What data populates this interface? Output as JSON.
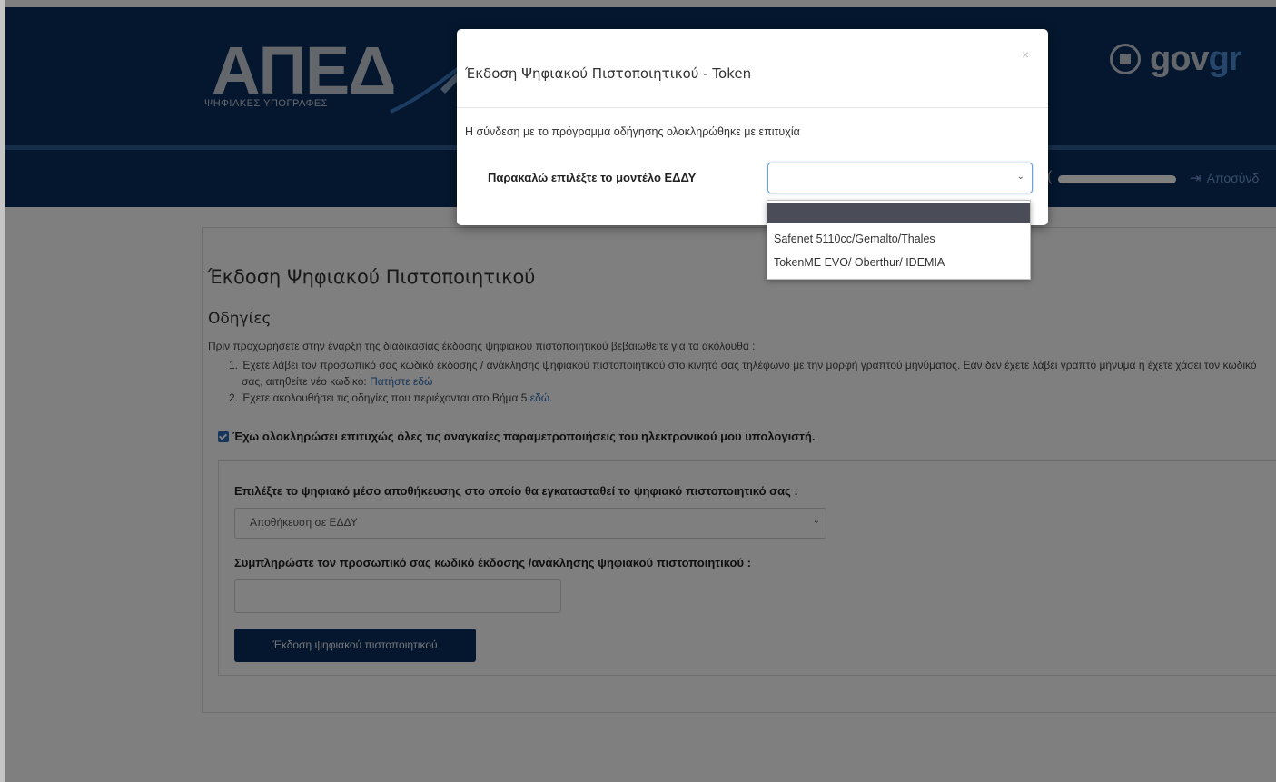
{
  "header": {
    "logo_text": "ΑΠΕΔ",
    "logo_subtitle": "ΨΗΦΙΑΚΕΣ ΥΠΟΓΡΑΦΕΣ",
    "gov_brand_gov": "gov",
    "gov_brand_gr": "gr",
    "user_paren": "(",
    "logout_label": "Αποσύνδ"
  },
  "main": {
    "title": "Έκδοση Ψηφιακού Πιστοποιητικού",
    "instructions_title": "Οδηγίες",
    "intro": "Πριν προχωρήσετε στην έναρξη της διαδικασίας έκδοσης ψηφιακού πιστοποιητικού βεβαιωθείτε για τα ακόλουθα :",
    "steps": [
      {
        "num": "1.",
        "text": "Έχετε λάβει τον προσωπικό σας κωδικό έκδοσης / ανάκλησης ψηφιακού πιστοποιητικού στο κινητό σας τηλέφωνο με την μορφή γραπτού μηνύματος. Εάν δεν έχετε λάβει γραπτό μήνυμα ή έχετε χάσει τον κωδικό σας, αιτηθείτε νέο κωδικό:",
        "link": "Πατήστε εδώ"
      },
      {
        "num": "2.",
        "text": "Έχετε ακολουθήσει τις οδηγίες που περιέχονται στο Βήμα 5",
        "link": "εδώ."
      }
    ],
    "checkbox_label": "Έχω ολοκληρώσει επιτυχώς όλες τις αναγκαίες παραμετροποιήσεις του ηλεκτρονικού μου υπολογιστή.",
    "storage_label": "Επιλέξτε το ψηφιακό μέσο αποθήκευσης στο οποίο θα εγκατασταθεί το ψηφιακό πιστοποιητικό σας :",
    "storage_value": "Αποθήκευση σε ΕΔΔΥ",
    "code_label": "Συμπληρώστε τον προσωπικό σας κωδικό έκδοσης /ανάκλησης ψηφιακού πιστοποιητικού :",
    "code_value": "",
    "issue_button": "Έκδοση ψηφιακού πιστοποιητικού"
  },
  "modal": {
    "title": "Έκδοση Ψηφιακού Πιστοποιητικού - Token",
    "close": "×",
    "message": "Η σύνδεση με το πρόγραμμα οδήγησης ολοκληρώθηκε με επιτυχία",
    "model_label": "Παρακαλώ επιλέξτε το μοντέλο ΕΔΔΥ",
    "model_value": "",
    "options": [
      "",
      "Safenet 5110cc/Gemalto/Thales",
      "TokenME EVO/ Oberthur/ IDEMIA"
    ]
  },
  "colors": {
    "header_bg": "#0b2e5c",
    "accent_blue": "#2a6db8",
    "gr_blue": "#4d8ed6",
    "button_bg": "#0b2e5c",
    "dropdown_selected": "#4a4d57"
  },
  "icons": {
    "close": "close-icon",
    "chevron": "chevron-down-icon",
    "logout": "logout-icon",
    "emblem": "gov-emblem-icon"
  }
}
